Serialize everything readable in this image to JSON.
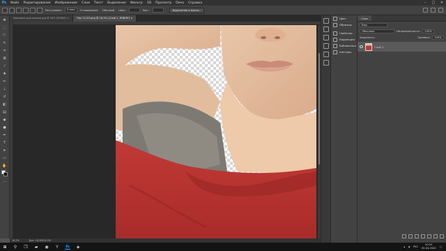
{
  "menubar": {
    "logo": "Ps",
    "items": [
      "Файл",
      "Редактирование",
      "Изображение",
      "Слои",
      "Текст",
      "Выделение",
      "Фильтр",
      "3D",
      "Просмотр",
      "Окно",
      "Справка"
    ]
  },
  "options": {
    "feather_label": "Растушевка:",
    "feather_value": "0 пикс",
    "antialias_label": "Сглаживание",
    "style_label": "Обычный",
    "width_label": "Шир.:",
    "height_label": "Выс.:",
    "select_mask_button": "Выделение и маска..."
  },
  "tabs": [
    {
      "label": "Аватарка для поиска.jpg @ 16% (RGB/8) ×",
      "active": false
    },
    {
      "label": "Пол 11.03.png @ 16,2% (Слой 1, RGB/8*) ×",
      "active": true
    }
  ],
  "status": {
    "zoom": "16,2%",
    "doc": "Док: 18,3M/34,1M"
  },
  "panel_mid": {
    "groups": [
      [
        "Цвет",
        "Образцы"
      ],
      [
        "Свойства",
        "Коррекция",
        "Библиотеки",
        "Контуры"
      ]
    ]
  },
  "layers_panel": {
    "tab": "Слои",
    "kind_label": "Вид",
    "blend_mode": "Обычные",
    "opacity_label": "Непрозрачность:",
    "opacity_value": "100%",
    "lock_label": "Закрепить:",
    "fill_label": "Заливка:",
    "fill_value": "100%",
    "layer_name": "Слой 1"
  },
  "taskbar": {
    "lang": "РУС",
    "time": "20:25",
    "date": "05.04.2020"
  }
}
